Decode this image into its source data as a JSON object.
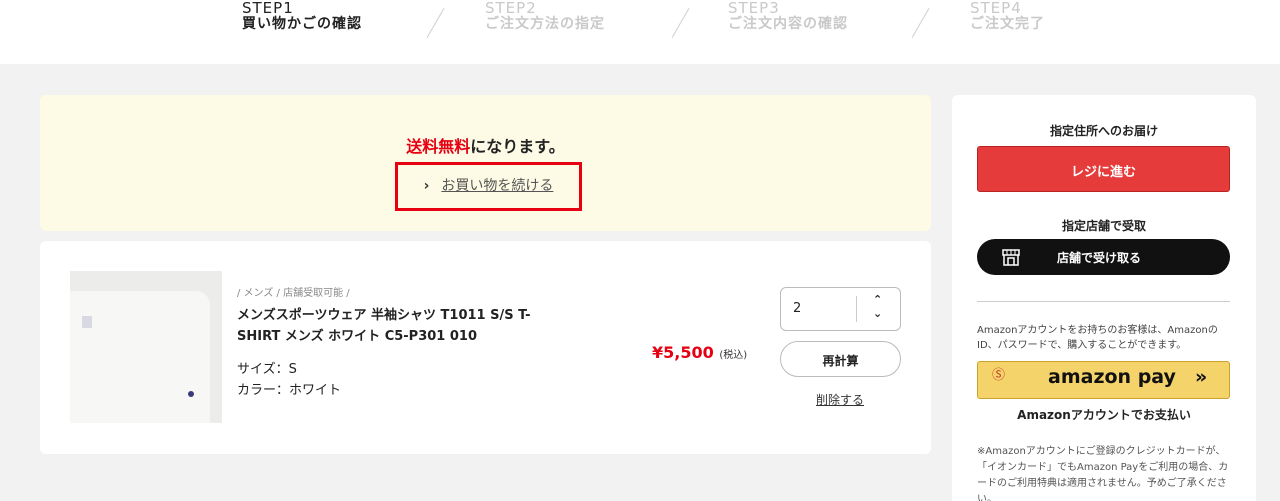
{
  "steps": [
    {
      "num": "STEP1",
      "label": "買い物かごの確認"
    },
    {
      "num": "STEP2",
      "label": "ご注文方法の指定"
    },
    {
      "num": "STEP3",
      "label": "ご注文内容の確認"
    },
    {
      "num": "STEP4",
      "label": "ご注文完了"
    }
  ],
  "notice": {
    "free_red": "送料無料",
    "free_rest": "になります。",
    "continue": "お買い物を続ける",
    "chevron": "›"
  },
  "item": {
    "breadcrumb": "/ メンズ / 店舗受取可能 /",
    "name": "メンズスポーツウェア 半袖シャツ T1011 S/S T-SHIRT メンズ ホワイト C5-P301 010",
    "size": "サイズ：S",
    "color": "カラー：ホワイト",
    "price": "¥5,500",
    "tax": "(税込)",
    "qty": "2",
    "recalc": "再計算",
    "delete": "削除する"
  },
  "sidebar": {
    "deliver_title": "指定住所へのお届け",
    "regi": "レジに進む",
    "store_title": "指定店舗で受取",
    "store_btn": "店舗で受け取る",
    "amazon_text": "Amazonアカウントをお持ちのお客様は、AmazonのID、パスワードで、購入することができます。",
    "amazon_s": "Ⓢ",
    "amazon_pay": "amazon pay",
    "amazon_go": "»",
    "amazon_caption": "Amazonアカウントでお支払い",
    "note": "※Amazonアカウントにご登録のクレジットカードが、「イオンカード」でもAmazon Payをご利用の場合、カードのご利用特典は適用されません。予めご了承ください。"
  },
  "colors": {
    "accent": "#e60012",
    "regi": "#e63b3b",
    "amazon": "#f5d36b"
  }
}
